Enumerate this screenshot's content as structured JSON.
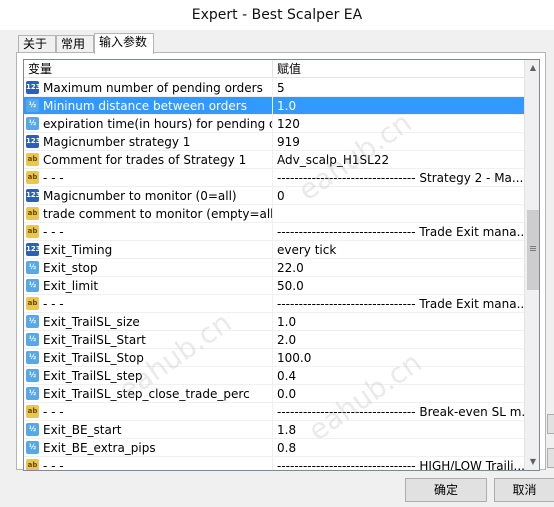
{
  "window": {
    "title": "Expert - Best Scalper EA"
  },
  "tabs": [
    {
      "label": "关于"
    },
    {
      "label": "常用"
    },
    {
      "label": "输入参数"
    }
  ],
  "grid": {
    "col_variable": "变量",
    "col_value": "赋值",
    "rows": [
      {
        "type": "int",
        "icon_label": "123",
        "name": "Maximum number of pending orders",
        "value": "5"
      },
      {
        "type": "dbl",
        "icon_label": "½",
        "name": "Mininum distance between orders",
        "value": "1.0",
        "selected": true
      },
      {
        "type": "dbl",
        "icon_label": "½",
        "name": "expiration time(in hours) for pending ord...",
        "value": "120"
      },
      {
        "type": "int",
        "icon_label": "123",
        "name": "Magicnumber strategy 1",
        "value": "919"
      },
      {
        "type": "str",
        "icon_label": "ab",
        "name": "Comment for trades of Strategy 1",
        "value": "Adv_scalp_H1SL22"
      },
      {
        "type": "str",
        "icon_label": "ab",
        "name": "- - -",
        "value": "-------------------------------- Strategy 2 - Ma..."
      },
      {
        "type": "int",
        "icon_label": "123",
        "name": "Magicnumber to monitor (0=all)",
        "value": "0"
      },
      {
        "type": "str",
        "icon_label": "ab",
        "name": "trade comment to monitor (empty=all)",
        "value": ""
      },
      {
        "type": "str",
        "icon_label": "ab",
        "name": "- - -",
        "value": "-------------------------------- Trade Exit mana..."
      },
      {
        "type": "int",
        "icon_label": "123",
        "name": "Exit_Timing",
        "value": "every tick"
      },
      {
        "type": "dbl",
        "icon_label": "½",
        "name": "Exit_stop",
        "value": "22.0"
      },
      {
        "type": "dbl",
        "icon_label": "½",
        "name": "Exit_limit",
        "value": "50.0"
      },
      {
        "type": "str",
        "icon_label": "ab",
        "name": "- - -",
        "value": "-------------------------------- Trade Exit mana..."
      },
      {
        "type": "dbl",
        "icon_label": "½",
        "name": "Exit_TrailSL_size",
        "value": "1.0"
      },
      {
        "type": "dbl",
        "icon_label": "½",
        "name": "Exit_TrailSL_Start",
        "value": "2.0"
      },
      {
        "type": "dbl",
        "icon_label": "½",
        "name": "Exit_TrailSL_Stop",
        "value": "100.0"
      },
      {
        "type": "dbl",
        "icon_label": "½",
        "name": "Exit_TrailSL_step",
        "value": "0.4"
      },
      {
        "type": "dbl",
        "icon_label": "½",
        "name": "Exit_TrailSL_step_close_trade_perc",
        "value": "0.0"
      },
      {
        "type": "str",
        "icon_label": "ab",
        "name": "- - -",
        "value": "-------------------------------- Break-even SL m..."
      },
      {
        "type": "dbl",
        "icon_label": "½",
        "name": "Exit_BE_start",
        "value": "1.8"
      },
      {
        "type": "dbl",
        "icon_label": "½",
        "name": "Exit_BE_extra_pips",
        "value": "0.8"
      },
      {
        "type": "str",
        "icon_label": "ab",
        "name": "- - -",
        "value": "-------------------------------- HIGH/LOW Traili..."
      }
    ]
  },
  "buttons": {
    "ok": "确定",
    "cancel": "取消"
  },
  "watermark": "eahub.cn",
  "colors": {
    "selection": "#3399ff",
    "int_icon": "#2b5fb8",
    "dbl_icon": "#56a8e6",
    "str_icon": "#e8c650"
  }
}
